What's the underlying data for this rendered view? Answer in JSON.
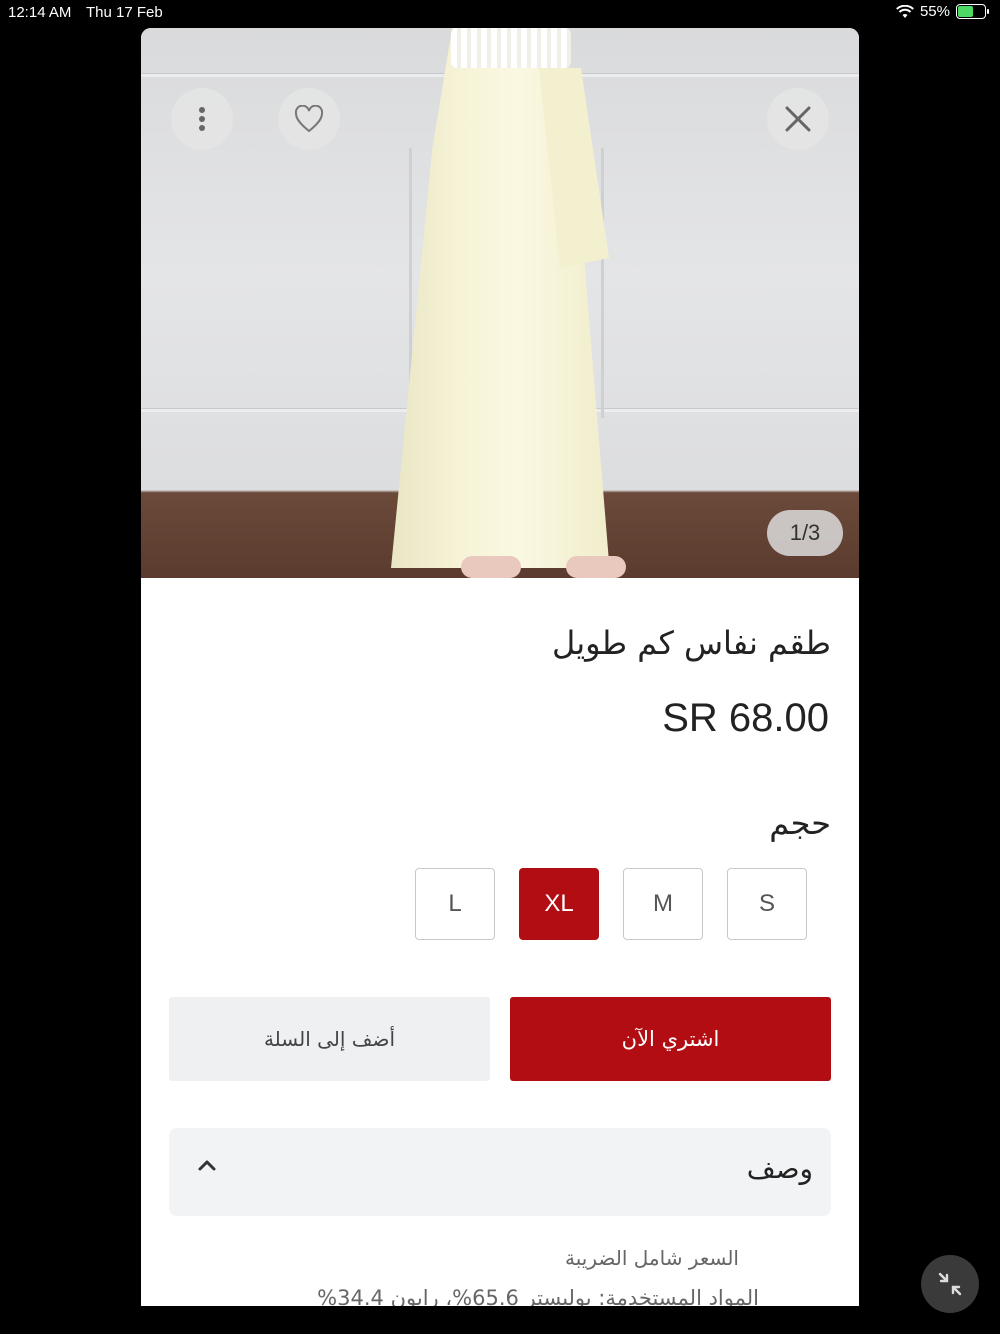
{
  "status_bar": {
    "time": "12:14 AM",
    "date": "Thu 17 Feb",
    "battery": "55%"
  },
  "gallery": {
    "counter": "1/3"
  },
  "product": {
    "title": "طقم نفاس كم طويل",
    "price": "SR 68.00",
    "size_label": "حجم",
    "sizes": [
      "L",
      "XL",
      "M",
      "S"
    ],
    "selected_size": "XL"
  },
  "actions": {
    "add_to_cart": "أضف إلى السلة",
    "buy_now": "اشتري الآن"
  },
  "description": {
    "title": "وصف",
    "line1": "السعر شامل الضريبة",
    "line2": "المواد المستخدمة: بوليستر 65.6%، رايون 34.4%"
  },
  "colors": {
    "accent": "#b30d14",
    "fab_bg": "#f3c9c9"
  }
}
